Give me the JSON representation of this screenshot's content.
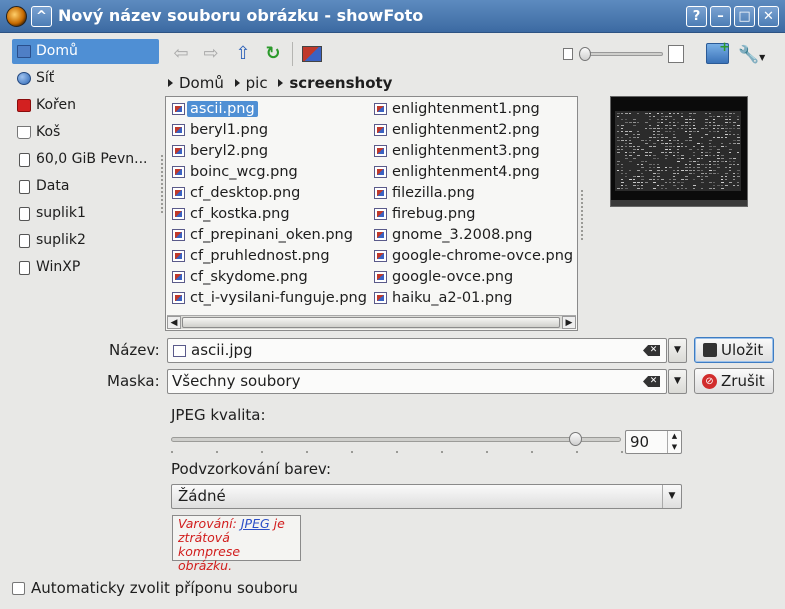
{
  "window": {
    "title": "Nový název souboru obrázku - showFoto",
    "buttons": {
      "help": "?",
      "minimize": "–",
      "maximize": "□",
      "close": "✕",
      "shade": "^"
    }
  },
  "sidebar": {
    "items": [
      {
        "label": "Domů",
        "icon": "home-icon"
      },
      {
        "label": "Síť",
        "icon": "network-icon"
      },
      {
        "label": "Kořen",
        "icon": "root-folder-icon"
      },
      {
        "label": "Koš",
        "icon": "trash-icon"
      },
      {
        "label": "60,0 GiB Pevn...",
        "icon": "drive-icon"
      },
      {
        "label": "Data",
        "icon": "drive-icon"
      },
      {
        "label": "suplik1",
        "icon": "drive-icon"
      },
      {
        "label": "suplik2",
        "icon": "drive-icon"
      },
      {
        "label": "WinXP",
        "icon": "drive-icon"
      }
    ],
    "selected": 0
  },
  "breadcrumb": {
    "items": [
      "Domů",
      "pic",
      "screenshoty"
    ]
  },
  "files": {
    "column1": [
      "ascii.png",
      "beryl1.png",
      "beryl2.png",
      "boinc_wcg.png",
      "cf_desktop.png",
      "cf_kostka.png",
      "cf_prepinani_oken.png",
      "cf_pruhlednost.png",
      "cf_skydome.png",
      "ct_i-vysilani-funguje.png"
    ],
    "column2": [
      "enlightenment1.png",
      "enlightenment2.png",
      "enlightenment3.png",
      "enlightenment4.png",
      "filezilla.png",
      "firebug.png",
      "gnome_3.2008.png",
      "google-chrome-ovce.png",
      "google-ovce.png",
      "haiku_a2-01.png"
    ],
    "selected": "ascii.png"
  },
  "form": {
    "name_label": "Název:",
    "name_value": "ascii.jpg",
    "mask_label": "Maska:",
    "mask_value": "Všechny soubory",
    "save_button": "Uložit",
    "cancel_button": "Zrušit",
    "jpeg_label": "JPEG kvalita:",
    "jpeg_value": "90",
    "jpeg_fraction": 0.9,
    "subsampling_label": "Podvzorkování barev:",
    "subsampling_value": "Žádné",
    "warning_prefix": "Varování:",
    "warning_link": "JPEG",
    "warning_suffix": "je ztrátová komprese obrázku.",
    "auto_ext_label": "Automaticky zvolit příponu souboru"
  },
  "toolbar": {
    "back": "⇦",
    "forward": "⇨",
    "up": "⇧",
    "reload": "↻"
  }
}
